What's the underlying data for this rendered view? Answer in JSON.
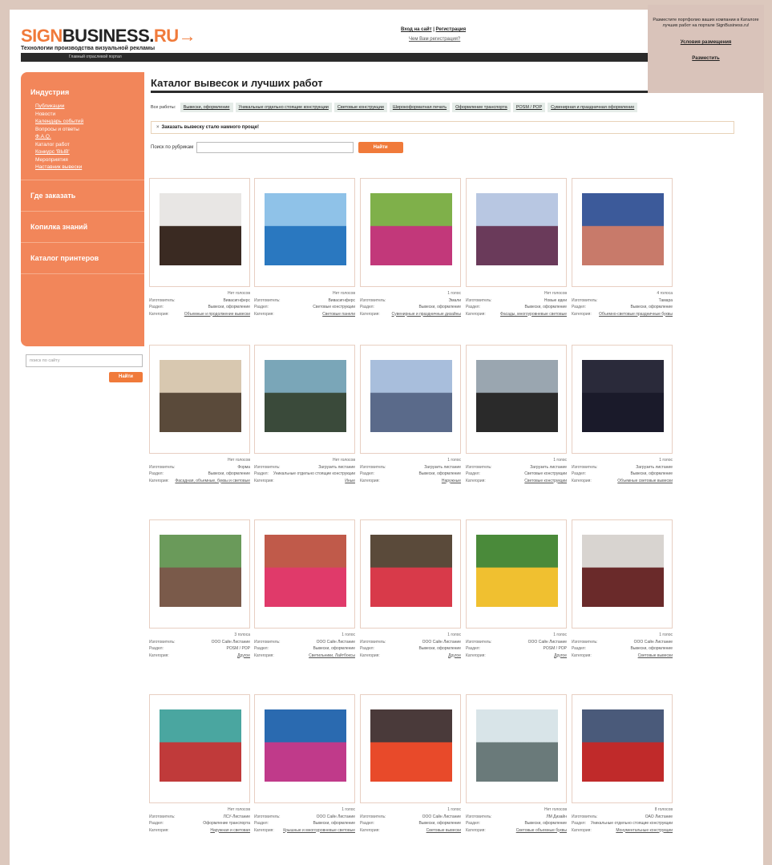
{
  "header": {
    "logo_part1": "SIGN",
    "logo_part2": "BUSINESS.",
    "logo_part3": "RU→",
    "tagline": "Технологии производства визуальной рекламы",
    "topbar_text": "Главный отраслевой портал"
  },
  "auth": {
    "login": "Вход на сайт",
    "sep": "|",
    "register": "Регистрация",
    "why_register": "Чем Вам регистрация?"
  },
  "promo": {
    "text": "Разместите портфолио ваших компании в Каталоге лучших работ на портале SignBusiness.ru!",
    "conditions": "Условия размещения",
    "place": "Разместить"
  },
  "sidebar": {
    "sections": [
      {
        "label": "Индустрия",
        "items": [
          {
            "label": "Публикации",
            "link": true
          },
          {
            "label": "Новости",
            "link": false
          },
          {
            "label": "Календарь событий",
            "link": true
          },
          {
            "label": "Вопросы и ответы",
            "link": false
          },
          {
            "label": "Ф.А.Q.",
            "link": true
          },
          {
            "label": "Каталог работ",
            "link": false
          },
          {
            "label": "Конкурс 'ВЫВ'",
            "link": true
          },
          {
            "label": "Мероприятия",
            "link": false
          },
          {
            "label": "Наставник вывески",
            "link": true
          }
        ]
      },
      {
        "label": "Где заказать",
        "items": []
      },
      {
        "label": "Копилка знаний",
        "items": []
      },
      {
        "label": "Каталог принтеров",
        "items": []
      }
    ],
    "search_placeholder": "поиск по сайту",
    "search_button": "Найти"
  },
  "main": {
    "title": "Каталог вывесок и лучших работ",
    "filters_label": "Все работы:",
    "filters": [
      "Вывески, оформление",
      "Уникальные отдельно стоящие конструкции",
      "Световые конструкции",
      "Широкоформатная печать",
      "Оформление транспорта",
      "POSM / POP",
      "Сувенирная и праздничная оформление"
    ],
    "notice": "Заказать вывеску стало намного проще!",
    "search_label": "Поиск по рубрикам",
    "search_button": "Найти"
  },
  "cards": [
    {
      "votes": "Нет голосов",
      "company_label": "Изготовитель:",
      "company": "Вивасигнферс",
      "rubric_label": "Раздел:",
      "rubric": "Вывески, оформление",
      "category_label": "Категория:",
      "category": "Объемные и продолжение вывески",
      "color": "#3a2a22",
      "bg": "#e8e6e4"
    },
    {
      "votes": "Нет голосов",
      "company_label": "Изготовитель:",
      "company": "Вивасигнферс",
      "rubric_label": "Раздел:",
      "rubric": "Световые конструкции",
      "category_label": "Категория:",
      "category": "Световые панели",
      "color": "#2a78c0",
      "bg": "#8fc2e8"
    },
    {
      "votes": "1 голос",
      "company_label": "Изготовитель:",
      "company": "Эмали",
      "rubric_label": "Раздел:",
      "rubric": "Вывески, оформление",
      "category_label": "Категория:",
      "category": "Сувенирные и праздничные дизайны",
      "color": "#c2387a",
      "bg": "#7fb04a"
    },
    {
      "votes": "Нет голосов",
      "company_label": "Изготовитель:",
      "company": "Новые идеи",
      "rubric_label": "Раздел:",
      "rubric": "Вывески, оформление",
      "category_label": "Категория:",
      "category": "Фасады, многоуровневые световые",
      "color": "#6a3a5a",
      "bg": "#b8c7e2"
    },
    {
      "votes": "4 голоса",
      "company_label": "Изготовитель:",
      "company": "Тамара",
      "rubric_label": "Раздел:",
      "rubric": "Вывески, оформление",
      "category_label": "Категория:",
      "category": "Объемно-световые праздничные буквы",
      "color": "#c87a6a",
      "bg": "#3c5a9a"
    },
    {
      "votes": "Нет голосов",
      "company_label": "Изготовитель:",
      "company": "Форма",
      "rubric_label": "Раздел:",
      "rubric": "Вывески, оформление",
      "category_label": "Категория:",
      "category": "Фасадная, объемные, буквы и световые",
      "color": "#5a4a3a",
      "bg": "#d8c8b0"
    },
    {
      "votes": "Нет голосов",
      "company_label": "Изготовитель:",
      "company": "Загрузить листание",
      "rubric_label": "Раздел:",
      "rubric": "Уникальные отдельно стоящие конструкции",
      "category_label": "Категория:",
      "category": "Иные",
      "color": "#3a4a3a",
      "bg": "#7aa6b8"
    },
    {
      "votes": "1 голос",
      "company_label": "Изготовитель:",
      "company": "Загрузить листание",
      "rubric_label": "Раздел:",
      "rubric": "Вывески, оформление",
      "category_label": "Категория:",
      "category": "Наружные",
      "color": "#5a6a8a",
      "bg": "#a8bedc"
    },
    {
      "votes": "1 голос",
      "company_label": "Изготовитель:",
      "company": "Загрузить листание",
      "rubric_label": "Раздел:",
      "rubric": "Световые конструкции",
      "category_label": "Категория:",
      "category": "Световые конструкции",
      "color": "#2a2a2a",
      "bg": "#9aa6b0"
    },
    {
      "votes": "1 голос",
      "company_label": "Изготовитель:",
      "company": "Загрузить листание",
      "rubric_label": "Раздел:",
      "rubric": "Вывески, оформление",
      "category_label": "Категория:",
      "category": "Объемные световые вывески",
      "color": "#1a1a2a",
      "bg": "#2a2a3a"
    },
    {
      "votes": "3 голоса",
      "company_label": "Изготовитель:",
      "company": "ООО Сайн Листание",
      "rubric_label": "Раздел:",
      "rubric": "POSM / POP",
      "category_label": "Категория:",
      "category": "Другое",
      "color": "#7a5a4a",
      "bg": "#6a9a5a"
    },
    {
      "votes": "1 голос",
      "company_label": "Изготовитель:",
      "company": "ООО Сайн Листание",
      "rubric_label": "Раздел:",
      "rubric": "Вывески, оформление",
      "category_label": "Категория:",
      "category": "Светильники, Лайтбоксы",
      "color": "#e03a6a",
      "bg": "#c05a4a"
    },
    {
      "votes": "1 голос",
      "company_label": "Изготовитель:",
      "company": "ООО Сайн Листание",
      "rubric_label": "Раздел:",
      "rubric": "Вывески, оформление",
      "category_label": "Категория:",
      "category": "Другое",
      "color": "#d83a4a",
      "bg": "#5a4a3a"
    },
    {
      "votes": "1 голос",
      "company_label": "Изготовитель:",
      "company": "ООО Сайн Листание",
      "rubric_label": "Раздел:",
      "rubric": "POSM / POP",
      "category_label": "Категория:",
      "category": "Другое",
      "color": "#f0c030",
      "bg": "#4a8a3a"
    },
    {
      "votes": "1 голос",
      "company_label": "Изготовитель:",
      "company": "ООО Сайн Листание",
      "rubric_label": "Раздел:",
      "rubric": "Вывески, оформление",
      "category_label": "Категория:",
      "category": "Световые вывески",
      "color": "#6a2a2a",
      "bg": "#d8d4d0"
    },
    {
      "votes": "Нет голосов",
      "company_label": "Изготовитель:",
      "company": "ЛСУ-Листание",
      "rubric_label": "Раздел:",
      "rubric": "Оформление транспорта",
      "category_label": "Категория:",
      "category": "Наружная и световая",
      "color": "#c03a3a",
      "bg": "#4aa6a0"
    },
    {
      "votes": "1 голос",
      "company_label": "Изготовитель:",
      "company": "ООО Сайн Листание",
      "rubric_label": "Раздел:",
      "rubric": "Вывески, оформление",
      "category_label": "Категория:",
      "category": "Крышные и многоуровневые световые",
      "color": "#c03a8a",
      "bg": "#2a6ab0"
    },
    {
      "votes": "1 голос",
      "company_label": "Изготовитель:",
      "company": "ООО Сайн Листание",
      "rubric_label": "Раздел:",
      "rubric": "Вывески, оформление",
      "category_label": "Категория:",
      "category": "Световые вывески",
      "color": "#e84a2a",
      "bg": "#4a3a3a"
    },
    {
      "votes": "Нет голосов",
      "company_label": "Изготовитель:",
      "company": "ЛМ Дизайн",
      "rubric_label": "Раздел:",
      "rubric": "Вывески, оформление",
      "category_label": "Категория:",
      "category": "Световые объемные буквы",
      "color": "#6a7a7a",
      "bg": "#d8e4e8"
    },
    {
      "votes": "8 голосов",
      "company_label": "Изготовитель:",
      "company": "ОАО Листание",
      "rubric_label": "Раздел:",
      "rubric": "Уникальные отдельно стоящие конструкции",
      "category_label": "Категория:",
      "category": "Монументальные конструкции",
      "color": "#c02a2a",
      "bg": "#4a5a7a"
    }
  ]
}
